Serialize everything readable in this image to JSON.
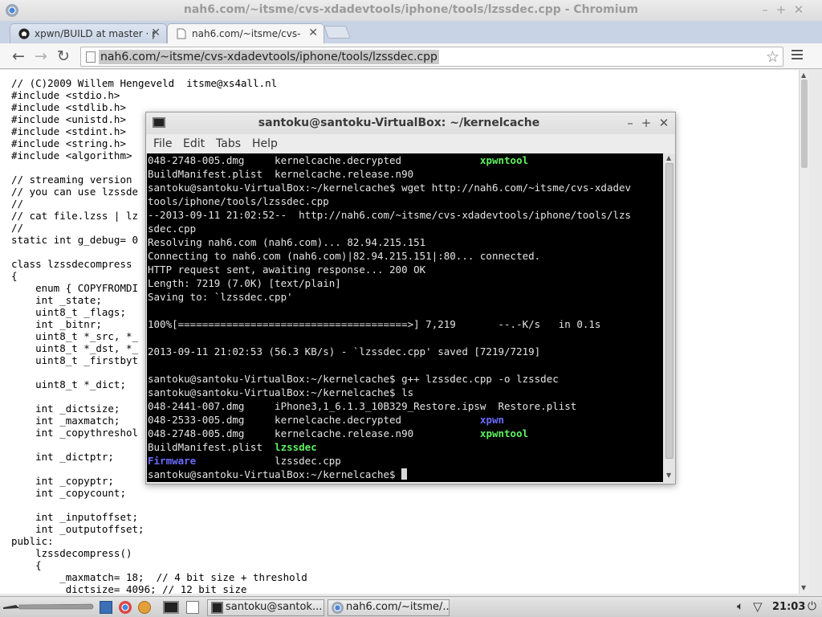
{
  "browser": {
    "title": "nah6.com/~itsme/cvs-xdadevtools/iphone/tools/lzssdec.cpp - Chromium",
    "tabs": [
      {
        "label": "xpwn/BUILD at master · p",
        "active": false
      },
      {
        "label": "nah6.com/~itsme/cvs-xda",
        "active": true
      }
    ],
    "url": "nah6.com/~itsme/cvs-xdadevtools/iphone/tools/lzssdec.cpp"
  },
  "source_lines": [
    "// (C)2009 Willem Hengeveld  itsme@xs4all.nl",
    "#include <stdio.h>",
    "#include <stdlib.h>",
    "#include <unistd.h>",
    "#include <stdint.h>",
    "#include <string.h>",
    "#include <algorithm>",
    "",
    "// streaming version",
    "// you can use lzssde",
    "//",
    "// cat file.lzss | lz",
    "//",
    "static int g_debug= 0",
    "",
    "class lzssdecompress",
    "{",
    "    enum { COPYFROMDI",
    "    int _state;",
    "    uint8_t _flags;",
    "    int _bitnr;",
    "    uint8_t *_src, *_",
    "    uint8_t *_dst, *_",
    "    uint8_t _firstbyt",
    "",
    "    uint8_t *_dict;",
    "",
    "    int _dictsize;",
    "    int _maxmatch;",
    "    int _copythreshol",
    "",
    "    int _dictptr;",
    "",
    "    int _copyptr;",
    "    int _copycount;",
    "",
    "    int _inputoffset;",
    "    int _outputoffset;",
    "public:",
    "    lzssdecompress()",
    "    {",
    "        _maxmatch= 18;  // 4 bit size + threshold",
    "        _dictsize= 4096; // 12 bit size"
  ],
  "terminal": {
    "title": "santoku@santoku-VirtualBox: ~/kernelcache",
    "menu": [
      "File",
      "Edit",
      "Tabs",
      "Help"
    ],
    "lines": [
      [
        {
          "t": "048-2748-005.dmg     kernelcache.decrypted             "
        },
        {
          "t": "xpwntool",
          "c": "green"
        }
      ],
      [
        {
          "t": "BuildManifest.plist  kernelcache.release.n90"
        }
      ],
      [
        {
          "t": "santoku@santoku-VirtualBox:~/kernelcache$ wget http://nah6.com/~itsme/cvs-xdadev"
        }
      ],
      [
        {
          "t": "tools/iphone/tools/lzssdec.cpp"
        }
      ],
      [
        {
          "t": "--2013-09-11 21:02:52--  http://nah6.com/~itsme/cvs-xdadevtools/iphone/tools/lzs"
        }
      ],
      [
        {
          "t": "sdec.cpp"
        }
      ],
      [
        {
          "t": "Resolving nah6.com (nah6.com)... 82.94.215.151"
        }
      ],
      [
        {
          "t": "Connecting to nah6.com (nah6.com)|82.94.215.151|:80... connected."
        }
      ],
      [
        {
          "t": "HTTP request sent, awaiting response... 200 OK"
        }
      ],
      [
        {
          "t": "Length: 7219 (7.0K) [text/plain]"
        }
      ],
      [
        {
          "t": "Saving to: `lzssdec.cpp'"
        }
      ],
      [
        {
          "t": ""
        }
      ],
      [
        {
          "t": "100%[======================================>] 7,219       --.-K/s   in 0.1s"
        }
      ],
      [
        {
          "t": ""
        }
      ],
      [
        {
          "t": "2013-09-11 21:02:53 (56.3 KB/s) - `lzssdec.cpp' saved [7219/7219]"
        }
      ],
      [
        {
          "t": ""
        }
      ],
      [
        {
          "t": "santoku@santoku-VirtualBox:~/kernelcache$ g++ lzssdec.cpp -o lzssdec"
        }
      ],
      [
        {
          "t": "santoku@santoku-VirtualBox:~/kernelcache$ ls"
        }
      ],
      [
        {
          "t": "048-2441-007.dmg     iPhone3,1_6.1.3_10B329_Restore.ipsw  Restore.plist"
        }
      ],
      [
        {
          "t": "048-2533-005.dmg     kernelcache.decrypted             "
        },
        {
          "t": "xpwn",
          "c": "blue"
        }
      ],
      [
        {
          "t": "048-2748-005.dmg     kernelcache.release.n90           "
        },
        {
          "t": "xpwntool",
          "c": "green"
        }
      ],
      [
        {
          "t": "BuildManifest.plist  "
        },
        {
          "t": "lzssdec",
          "c": "green"
        }
      ],
      [
        {
          "t": "Firmware",
          "c": "blue"
        },
        {
          "t": "             lzssdec.cpp"
        }
      ],
      [
        {
          "t": "santoku@santoku-VirtualBox:~/kernelcache$ "
        },
        {
          "cursor": true
        }
      ]
    ]
  },
  "taskbar": {
    "tasks": [
      {
        "label": "santoku@santok..."
      },
      {
        "label": "nah6.com/~itsme/..."
      }
    ],
    "clock": "21:03"
  },
  "colors": {
    "terminal_bg": "#000000",
    "exec_green": "#5ff25f",
    "dir_blue": "#6b6bff"
  }
}
